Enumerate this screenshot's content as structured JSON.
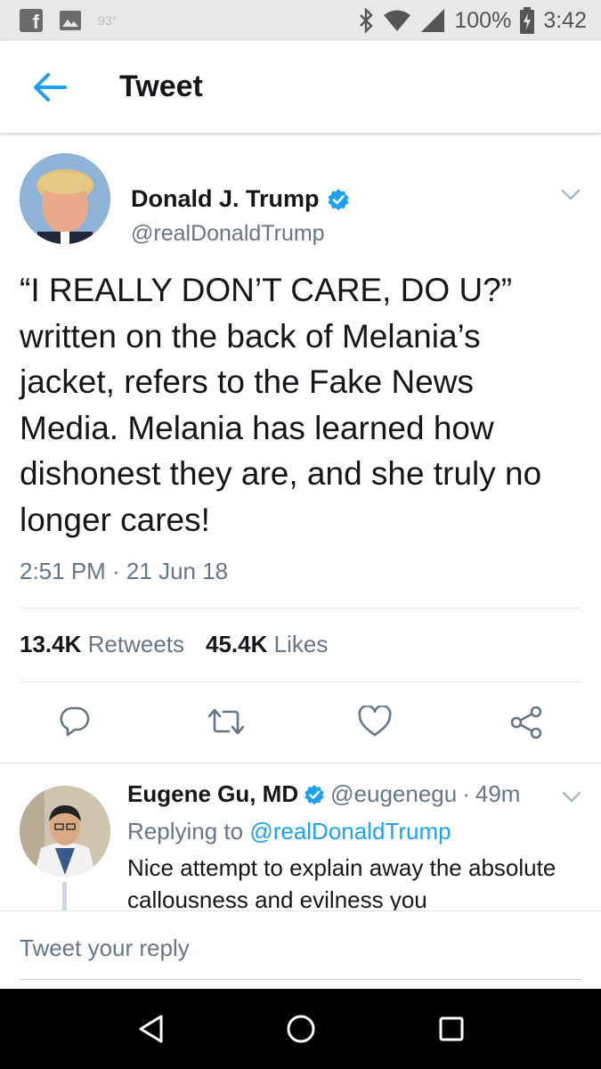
{
  "status_bar": {
    "temperature": "93°",
    "battery": "100%",
    "time": "3:42",
    "icons": [
      "facebook-icon",
      "photo-icon",
      "bluetooth-icon",
      "wifi-icon",
      "signal-icon",
      "battery-icon"
    ]
  },
  "app_bar": {
    "title": "Tweet",
    "back_icon": "arrow-left-icon"
  },
  "tweet": {
    "author_name": "Donald J. Trump",
    "author_handle": "@realDonaldTrump",
    "verified": true,
    "text": "“I REALLY DON’T CARE, DO U?” written on the back of Melania’s jacket, refers to the Fake News Media. Melania has learned how dishonest they are, and she truly no longer cares!",
    "timestamp": "2:51 PM · 21 Jun 18",
    "retweet_count": "13.4K",
    "retweet_label": "Retweets",
    "like_count": "45.4K",
    "like_label": "Likes",
    "actions": [
      "reply-icon",
      "retweet-icon",
      "like-icon",
      "share-icon"
    ]
  },
  "reply": {
    "author_name": "Eugene Gu, MD",
    "author_handle": "@eugenegu",
    "separator": "·",
    "time": "49m",
    "replying_prefix": "Replying to",
    "replying_to": "@realDonaldTrump",
    "text": "Nice attempt to explain away the absolute callousness and evilness you"
  },
  "compose": {
    "placeholder": "Tweet your reply"
  },
  "colors": {
    "accent": "#1da1f2",
    "text_primary": "#14171a",
    "text_secondary": "#657786",
    "status_bar_bg": "#e8e8e8",
    "nav_bar_bg": "#000000"
  }
}
